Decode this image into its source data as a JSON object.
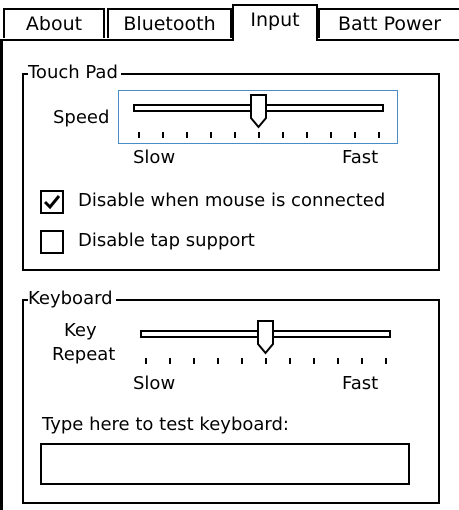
{
  "tabs": [
    {
      "label": "About",
      "active": false
    },
    {
      "label": "Bluetooth",
      "active": false
    },
    {
      "label": "Input",
      "active": true
    },
    {
      "label": "Batt Power",
      "active": false
    }
  ],
  "touchpad": {
    "group_label": "Touch Pad",
    "speed_label": "Speed",
    "slow_label": "Slow",
    "fast_label": "Fast",
    "speed_value": 0.5,
    "checkbox_disable_mouse": {
      "label": "Disable when mouse is connected",
      "checked": true
    },
    "checkbox_disable_tap": {
      "label": "Disable tap support",
      "checked": false
    }
  },
  "keyboard": {
    "group_label": "Keyboard",
    "repeat_label_line1": "Key",
    "repeat_label_line2": "Repeat",
    "slow_label": "Slow",
    "fast_label": "Fast",
    "repeat_value": 0.5,
    "test_label": "Type here to test keyboard:",
    "test_input_value": ""
  },
  "colors": {
    "focus_border": "#4a8cc7",
    "background": "#ffffff",
    "foreground": "#000000"
  }
}
